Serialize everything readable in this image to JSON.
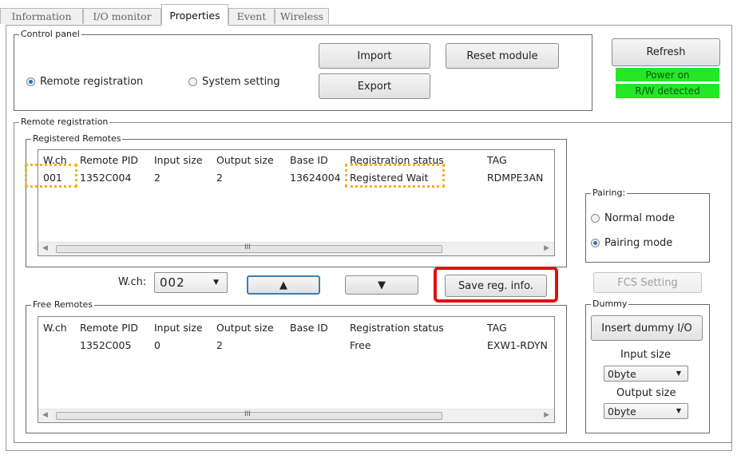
{
  "tabs": [
    {
      "label": "Information"
    },
    {
      "label": "I/O monitor"
    },
    {
      "label": "Properties"
    },
    {
      "label": "Event"
    },
    {
      "label": "Wireless"
    }
  ],
  "control_panel": {
    "legend": "Control panel",
    "import_label": "Import",
    "export_label": "Export",
    "reset_label": "Reset module",
    "radio_remote": "Remote registration",
    "radio_system": "System setting",
    "selected": "Remote registration"
  },
  "refresh_label": "Refresh",
  "status": {
    "power": "Power on",
    "rw": "R/W detected",
    "color": "#26e626"
  },
  "remote_registration": {
    "legend": "Remote registration",
    "registered": {
      "legend": "Registered Remotes",
      "columns": [
        "W.ch",
        "Remote PID",
        "Input size",
        "Output size",
        "Base ID",
        "Registration status",
        "TAG"
      ],
      "rows": [
        [
          "001",
          "1352C004",
          "2",
          "2",
          "13624004",
          "Registered Wait",
          "RDMPE3AN"
        ]
      ]
    },
    "wch_label": "W.ch:",
    "wch_value": "002",
    "up_label": "▲",
    "down_label": "▼",
    "save_label": "Save reg. info.",
    "free": {
      "legend": "Free Remotes",
      "columns": [
        "W.ch",
        "Remote PID",
        "Input size",
        "Output size",
        "Base ID",
        "Registration status",
        "TAG"
      ],
      "rows": [
        [
          "",
          "1352C005",
          "0",
          "2",
          "",
          "Free",
          "EXW1-RDYN"
        ]
      ]
    }
  },
  "pairing": {
    "legend": "Pairing:",
    "normal": "Normal mode",
    "pairing_mode": "Pairing mode",
    "selected": "Pairing mode"
  },
  "fcs_label": "FCS Setting",
  "dummy": {
    "legend": "Dummy",
    "insert_label": "Insert dummy I/O",
    "input_size_label": "Input size",
    "input_size_value": "0byte",
    "output_size_label": "Output size",
    "output_size_value": "0byte"
  },
  "scrollbar_glyph": "III",
  "highlight_colors": {
    "callout_dotted": "#f5b21c",
    "callout_box": "#e11010"
  }
}
